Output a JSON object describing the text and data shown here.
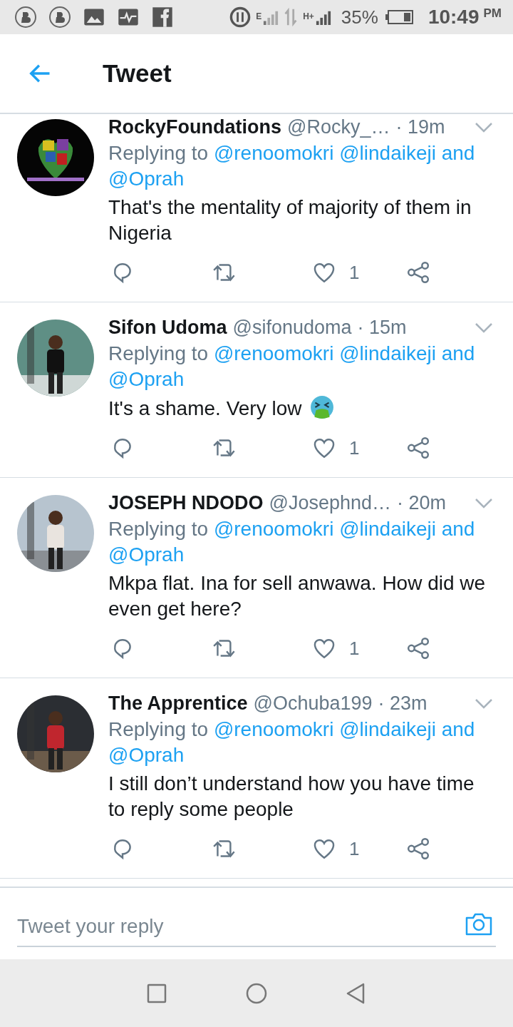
{
  "status_bar": {
    "net_labels": [
      "E",
      "H+"
    ],
    "battery": "35%",
    "time": "10:49",
    "meridiem": "PM"
  },
  "app_bar": {
    "title": "Tweet"
  },
  "tweets": [
    {
      "name": "RockyFoundations",
      "handle": "@Rocky_…",
      "time": "· 19m",
      "replying_label": "Replying to",
      "mentions": "@renoomokri @lindaikeji and @Oprah",
      "body": "That's the mentality of majority of them in Nigeria",
      "likes": "1",
      "avatar": {
        "kind": "logo"
      }
    },
    {
      "name": "Sifon Udoma",
      "handle": "@sifonudoma",
      "time": "· 15m",
      "replying_label": "Replying to",
      "mentions": "@renoomokri @lindaikeji and @Oprah",
      "body": "It's a shame. Very low",
      "emoji": {
        "kind": "vomiting-face"
      },
      "likes": "1"
    },
    {
      "name": "JOSEPH NDODO",
      "handle": "@Josephnd…",
      "time": "· 20m",
      "replying_label": "Replying to",
      "mentions": "@renoomokri @lindaikeji and @Oprah",
      "body": "Mkpa flat. Ina for sell anwawa. How did we even get here?",
      "likes": "1"
    },
    {
      "name": "The Apprentice",
      "handle": "@Ochuba199",
      "time": "· 23m",
      "replying_label": "Replying to",
      "mentions": "@renoomokri @lindaikeji and @Oprah",
      "body": "I still don’t understand how you have time to reply some people",
      "likes": "1"
    }
  ],
  "reply_bar": {
    "placeholder": "Tweet your reply"
  }
}
